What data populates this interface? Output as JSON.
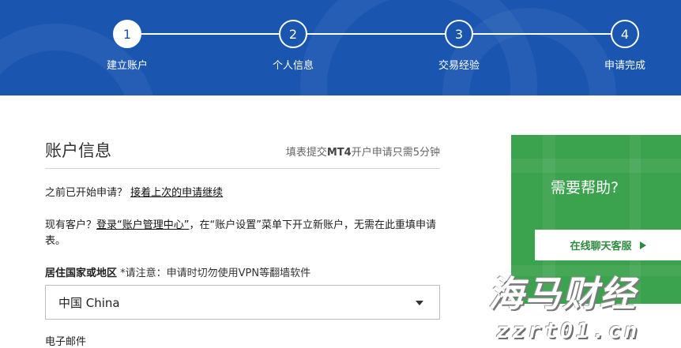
{
  "stepper": {
    "steps": [
      {
        "number": "1",
        "label": "建立账户",
        "active": true
      },
      {
        "number": "2",
        "label": "个人信息",
        "active": false
      },
      {
        "number": "3",
        "label": "交易经验",
        "active": false
      },
      {
        "number": "4",
        "label": "申请完成",
        "active": false
      }
    ]
  },
  "form": {
    "section_title": "账户信息",
    "section_note_prefix": "填表提交",
    "section_note_bold": "MT4",
    "section_note_suffix": "开户申请只需5分钟",
    "resume_prefix": "之前已开始申请？",
    "resume_link": "接着上次的申请继续",
    "existing_prefix": "现有客户？",
    "existing_link": "登录“账户管理中心”",
    "existing_suffix": "，在“账户设置”菜单下开立新账户，无需在此重填申请表。",
    "country_label": "居住国家或地区",
    "country_note": "*请注意：申请时切勿使用VPN等翻墙软件",
    "country_value": "中国 China",
    "email_label": "电子邮件"
  },
  "help": {
    "title": "需要帮助?",
    "button_label": "在线聊天客服"
  },
  "watermark": {
    "line1": "海马财经",
    "line2": "zzrt01.cn"
  },
  "colors": {
    "header_blue": "#1a56b0",
    "help_green": "#3ba24d"
  }
}
